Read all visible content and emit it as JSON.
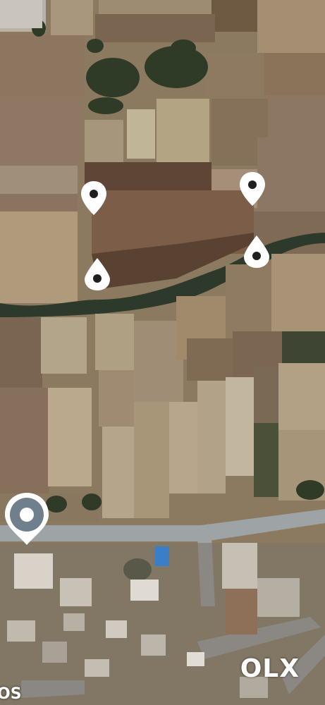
{
  "map": {
    "type": "satellite",
    "markers": [
      {
        "kind": "pin",
        "icon": "map-pin-icon"
      },
      {
        "kind": "pin",
        "icon": "map-pin-icon"
      },
      {
        "kind": "drop",
        "icon": "water-drop-icon"
      },
      {
        "kind": "drop",
        "icon": "water-drop-icon"
      }
    ],
    "current_location_icon": "location-dot-icon"
  },
  "watermark": {
    "text": "OLX"
  },
  "corner_label": {
    "text": "OS"
  },
  "colors": {
    "marker_white": "#ffffff",
    "marker_dark": "#1f1f1f",
    "road": "#9ea3a6",
    "vegetation": "#2f3b26"
  }
}
